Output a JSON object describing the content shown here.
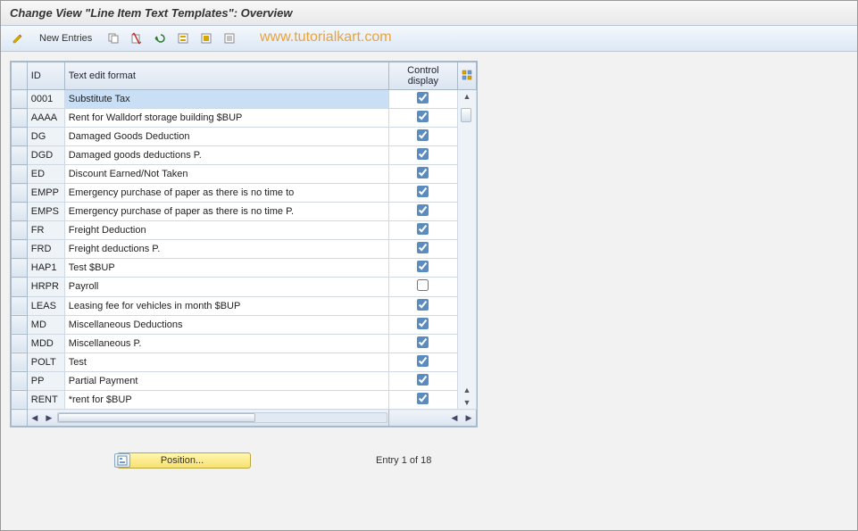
{
  "title": "Change View \"Line Item Text Templates\": Overview",
  "toolbar": {
    "new_entries_label": "New Entries"
  },
  "watermark": "www.tutorialkart.com",
  "columns": {
    "id": "ID",
    "text": "Text edit format",
    "control": "Control display"
  },
  "rows": [
    {
      "id": "0001",
      "text": "Substitute Tax",
      "checked": true,
      "selected": true
    },
    {
      "id": "AAAA",
      "text": "Rent for Walldorf storage building $BUP",
      "checked": true,
      "selected": false
    },
    {
      "id": "DG",
      "text": "Damaged Goods Deduction",
      "checked": true,
      "selected": false
    },
    {
      "id": "DGD",
      "text": "Damaged goods deductions P.",
      "checked": true,
      "selected": false
    },
    {
      "id": "ED",
      "text": "Discount Earned/Not Taken",
      "checked": true,
      "selected": false
    },
    {
      "id": "EMPP",
      "text": "Emergency purchase of paper as there is no time to",
      "checked": true,
      "selected": false
    },
    {
      "id": "EMPS",
      "text": "Emergency purchase of paper as there is no time P.",
      "checked": true,
      "selected": false
    },
    {
      "id": "FR",
      "text": "Freight Deduction",
      "checked": true,
      "selected": false
    },
    {
      "id": "FRD",
      "text": "Freight deductions P.",
      "checked": true,
      "selected": false
    },
    {
      "id": "HAP1",
      "text": "Test $BUP",
      "checked": true,
      "selected": false
    },
    {
      "id": "HRPR",
      "text": "Payroll",
      "checked": false,
      "selected": false
    },
    {
      "id": "LEAS",
      "text": "Leasing fee for vehicles in month $BUP",
      "checked": true,
      "selected": false
    },
    {
      "id": "MD",
      "text": "Miscellaneous Deductions",
      "checked": true,
      "selected": false
    },
    {
      "id": "MDD",
      "text": "Miscellaneous P.",
      "checked": true,
      "selected": false
    },
    {
      "id": "POLT",
      "text": "Test",
      "checked": true,
      "selected": false
    },
    {
      "id": "PP",
      "text": "Partial Payment",
      "checked": true,
      "selected": false
    },
    {
      "id": "RENT",
      "text": "*rent for $BUP",
      "checked": true,
      "selected": false
    }
  ],
  "footer": {
    "position_label": "Position...",
    "entry_text": "Entry 1 of 18"
  }
}
